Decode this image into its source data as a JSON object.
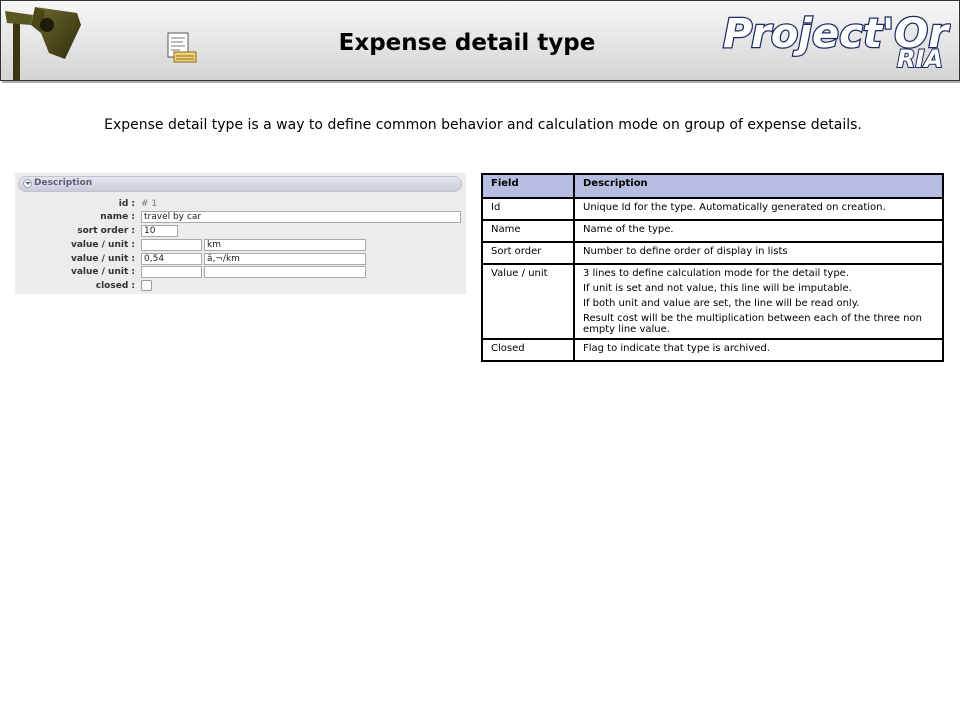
{
  "header": {
    "title": "Expense detail type",
    "logo_main": "Project'Or",
    "logo_sub": "RIA",
    "icons": {
      "left": "spotlight-icon",
      "doc": "document-icon"
    }
  },
  "intro": "Expense detail type is a way to define common behavior and calculation mode on group of expense details.",
  "form": {
    "section_title": "Description",
    "id_label": "id :",
    "id_value": "# 1",
    "name_label": "name :",
    "name_value": "travel by car",
    "sort_label": "sort order :",
    "sort_value": "10",
    "value_unit_label": "value / unit :",
    "lines": [
      {
        "value": "",
        "unit": "km"
      },
      {
        "value": "0,54",
        "unit": "â‚¬/km"
      },
      {
        "value": "",
        "unit": ""
      }
    ],
    "closed_label": "closed :"
  },
  "table": {
    "headers": [
      "Field",
      "Description"
    ],
    "rows": [
      {
        "field": "Id",
        "desc": [
          "Unique Id for the type. Automatically generated on creation."
        ]
      },
      {
        "field": "Name",
        "desc": [
          "Name of the type."
        ]
      },
      {
        "field": "Sort order",
        "desc": [
          "Number to define order of display in lists"
        ]
      },
      {
        "field": "Value / unit",
        "desc": [
          "3 lines to define calculation mode for the detail type.",
          "If unit is set and not value, this line will be imputable.",
          "If both unit and value are set, the line will be read only.",
          "Result cost will be the multiplication between each of the three non empty line value."
        ]
      },
      {
        "field": "Closed",
        "desc": [
          "Flag to indicate that type is archived."
        ]
      }
    ]
  },
  "colors": {
    "header_row": "#b7bde0",
    "logo_blue": "#1d2c64"
  }
}
